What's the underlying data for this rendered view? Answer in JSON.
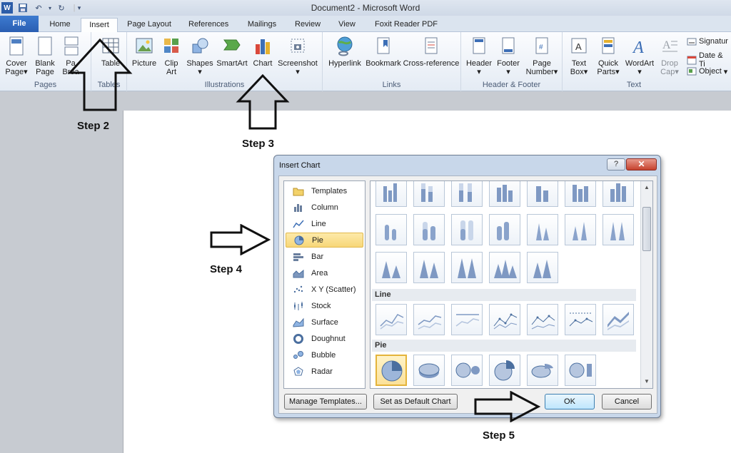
{
  "window": {
    "title": "Document2 - Microsoft Word",
    "faded_title": "Document2 - Microsoft Word"
  },
  "tabs": [
    {
      "label": "File"
    },
    {
      "label": "Home"
    },
    {
      "label": "Insert"
    },
    {
      "label": "Page Layout"
    },
    {
      "label": "References"
    },
    {
      "label": "Mailings"
    },
    {
      "label": "Review"
    },
    {
      "label": "View"
    },
    {
      "label": "Foxit Reader PDF"
    }
  ],
  "ribbon": {
    "groups": {
      "pages": "Pages",
      "tables": "Tables",
      "illustrations": "Illustrations",
      "links": "Links",
      "header_footer": "Header & Footer",
      "text": "Text"
    },
    "buttons": {
      "cover_page_1": "Cover",
      "cover_page_2": "Page",
      "blank_page_1": "Blank",
      "blank_page_2": "Page",
      "page_break_1": "Pa",
      "page_break_2": "Brea",
      "table": "Table",
      "picture": "Picture",
      "clip_art_1": "Clip",
      "clip_art_2": "Art",
      "shapes": "Shapes",
      "smartart": "SmartArt",
      "chart": "Chart",
      "screenshot": "Screenshot",
      "hyperlink": "Hyperlink",
      "bookmark": "Bookmark",
      "cross_reference": "Cross-reference",
      "header": "Header",
      "footer": "Footer",
      "page_number_1": "Page",
      "page_number_2": "Number",
      "text_box_1": "Text",
      "text_box_2": "Box",
      "quick_parts_1": "Quick",
      "quick_parts_2": "Parts",
      "wordart": "WordArt",
      "drop_cap_1": "Drop",
      "drop_cap_2": "Cap",
      "signature": "Signatur",
      "date_time": "Date & Ti",
      "object": "Object"
    }
  },
  "annotations": {
    "step2": "Step 2",
    "step3": "Step 3",
    "step4": "Step 4",
    "step5": "Step 5"
  },
  "dialog": {
    "title": "Insert Chart",
    "help": "?",
    "close": "✕",
    "categories": [
      {
        "label": "Templates"
      },
      {
        "label": "Column"
      },
      {
        "label": "Line"
      },
      {
        "label": "Pie"
      },
      {
        "label": "Bar"
      },
      {
        "label": "Area"
      },
      {
        "label": "X Y (Scatter)"
      },
      {
        "label": "Stock"
      },
      {
        "label": "Surface"
      },
      {
        "label": "Doughnut"
      },
      {
        "label": "Bubble"
      },
      {
        "label": "Radar"
      }
    ],
    "selected_category": "Pie",
    "sections": {
      "line": "Line",
      "pie": "Pie"
    },
    "buttons": {
      "manage_templates": "Manage Templates...",
      "set_default": "Set as Default Chart",
      "ok": "OK",
      "cancel": "Cancel"
    }
  },
  "colors": {
    "file_tab": "#2a5eb2",
    "selection": "#f7d778",
    "dialog_frame": "#c8d7ea",
    "close_button": "#c6412d"
  }
}
